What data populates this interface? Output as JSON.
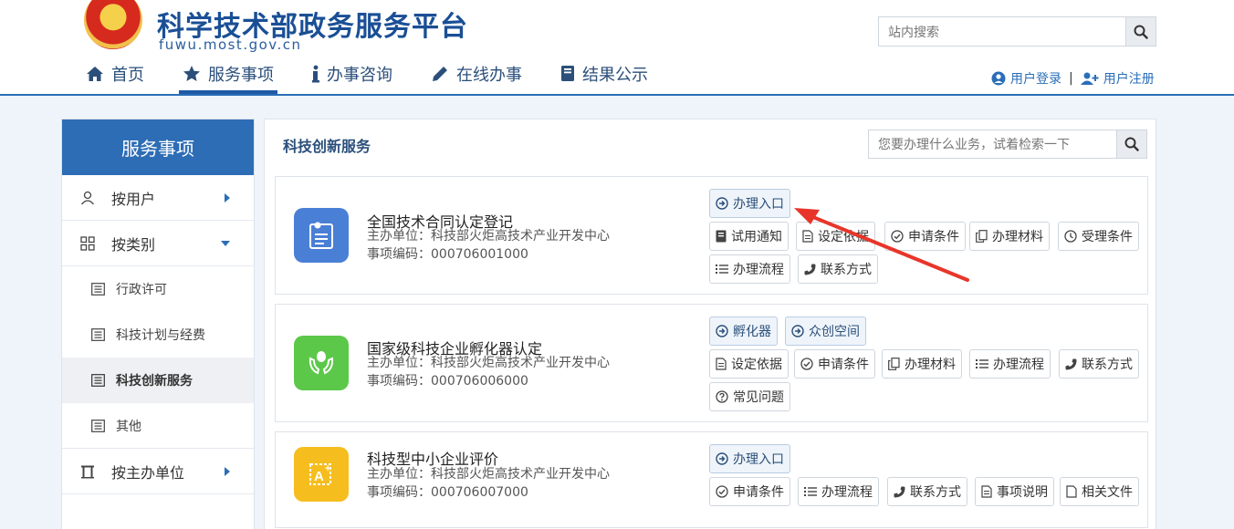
{
  "header": {
    "site_title": "科学技术部政务服务平台",
    "site_url": "fuwu.most.gov.cn",
    "search_placeholder": "站内搜索"
  },
  "nav": {
    "home": "首页",
    "services": "服务事项",
    "consult": "办事咨询",
    "online": "在线办事",
    "results": "结果公示"
  },
  "user": {
    "login": "用户登录",
    "separator": "|",
    "register": "用户注册"
  },
  "sidebar": {
    "title": "服务事项",
    "by_user": "按用户",
    "by_category": "按类别",
    "sub": [
      "行政许可",
      "科技计划与经费",
      "科技创新服务",
      "其他"
    ],
    "by_unit": "按主办单位"
  },
  "main": {
    "title": "科技创新服务",
    "search_placeholder": "您要办理什么业务，试着检索一下"
  },
  "cards": [
    {
      "title": "全国技术合同认定登记",
      "unit": "主办单位：科技部火炬高技术产业开发中心",
      "code": "事项编码：000706001000",
      "icon_color": "#4a7fd6",
      "entries": [
        "办理入口"
      ],
      "buttons": [
        "试用通知",
        "设定依据",
        "申请条件",
        "办理材料",
        "受理条件",
        "办理流程",
        "联系方式"
      ]
    },
    {
      "title": "国家级科技企业孵化器认定",
      "unit": "主办单位：科技部火炬高技术产业开发中心",
      "code": "事项编码：000706006000",
      "icon_color": "#5cc84a",
      "entries": [
        "孵化器",
        "众创空间"
      ],
      "buttons": [
        "设定依据",
        "申请条件",
        "办理材料",
        "办理流程",
        "联系方式",
        "常见问题"
      ]
    },
    {
      "title": "科技型中小企业评价",
      "unit": "主办单位：科技部火炬高技术产业开发中心",
      "code": "事项编码：000706007000",
      "icon_color": "#f6bd1f",
      "entries": [
        "办理入口"
      ],
      "buttons": [
        "申请条件",
        "办理流程",
        "联系方式",
        "事项说明",
        "相关文件"
      ]
    }
  ],
  "colors": {
    "brand_blue": "#2d6db5",
    "arrow_red": "#e8352a"
  }
}
